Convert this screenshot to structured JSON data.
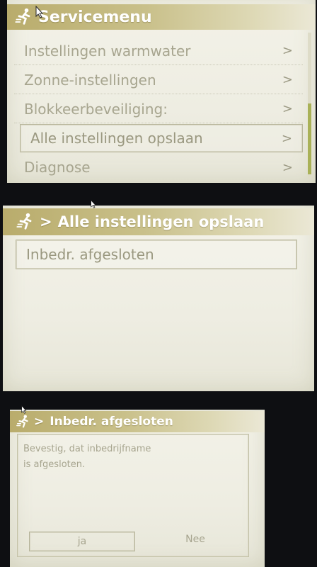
{
  "screen1": {
    "title": "Servicemenu",
    "items": [
      {
        "label": "Instellingen warmwater",
        "arrow": ">"
      },
      {
        "label": "Zonne-instellingen",
        "arrow": ">"
      },
      {
        "label": "Blokkeerbeveiliging:",
        "arrow": ">"
      },
      {
        "label": "Alle instellingen opslaan",
        "arrow": ">",
        "selected": true
      },
      {
        "label": "Diagnose",
        "arrow": ">"
      }
    ]
  },
  "screen2": {
    "chevron": ">",
    "title": "Alle instellingen opslaan",
    "items": [
      {
        "label": "Inbedr. afgesloten",
        "selected": true
      }
    ]
  },
  "screen3": {
    "chevron": ">",
    "title": "Inbedr. afgesloten",
    "message_line1": "Bevestig, dat inbedrijfname",
    "message_line2": "is afgesloten.",
    "yes_label": "ja",
    "no_label": "Nee"
  },
  "icons": {
    "title_icon": "service-runner-icon",
    "pointer": "mouse-pointer-icon"
  },
  "colors": {
    "title_bar": "#b9ac6c",
    "text_inactive": "#a7a58f",
    "scroll_thumb": "#a9b157",
    "screen_bg": "#f3f2e8"
  }
}
